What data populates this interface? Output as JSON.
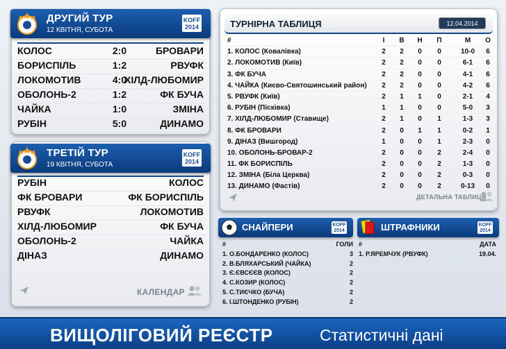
{
  "tour1": {
    "title": "ДРУГИЙ ТУР",
    "date": "12 КВІТНЯ, СУБОТА",
    "matches": [
      {
        "home": "КОЛОС",
        "score": "2:0",
        "away": "БРОВАРИ"
      },
      {
        "home": "БОРИСПІЛЬ",
        "score": "1:2",
        "away": "РВУФК"
      },
      {
        "home": "ЛОКОМОТИВ",
        "score": "4:0",
        "away": "ХІЛД-ЛЮБОМИР"
      },
      {
        "home": "ОБОЛОНЬ-2",
        "score": "1:2",
        "away": "ФК БУЧА"
      },
      {
        "home": "ЧАЙКА",
        "score": "1:0",
        "away": "ЗМІНА"
      },
      {
        "home": "РУБІН",
        "score": "5:0",
        "away": "ДИНАМО"
      }
    ]
  },
  "tour2": {
    "title": "ТРЕТІЙ ТУР",
    "date": "19 КВІТНЯ, СУБОТА",
    "matches": [
      {
        "home": "РУБІН",
        "away": "КОЛОС"
      },
      {
        "home": "ФК БРОВАРИ",
        "away": "ФК БОРИСПІЛЬ"
      },
      {
        "home": "РВУФК",
        "away": "ЛОКОМОТИВ"
      },
      {
        "home": "ХІЛД-ЛЮБОМИР",
        "away": "ФК БУЧА"
      },
      {
        "home": "ОБОЛОНЬ-2",
        "away": "ЧАЙКА"
      },
      {
        "home": "ДІНАЗ",
        "away": "ДИНАМО"
      }
    ],
    "calendar_label": "КАЛЕНДАР"
  },
  "koff": {
    "line1": "KOFF",
    "line2": "2014"
  },
  "standings": {
    "title": "ТУРНІРНА ТАБЛИЦЯ",
    "date": "12.04.2014",
    "headers": [
      "#",
      "І",
      "В",
      "Н",
      "П",
      "М",
      "О"
    ],
    "rows": [
      {
        "team": "1. КОЛОС (Ковалівка)",
        "g": "2",
        "w": "2",
        "d": "0",
        "l": "0",
        "gd": "10-0",
        "p": "6"
      },
      {
        "team": "2. ЛОКОМОТИВ (Київ)",
        "g": "2",
        "w": "2",
        "d": "0",
        "l": "0",
        "gd": "6-1",
        "p": "6"
      },
      {
        "team": "3. ФК БУЧА",
        "g": "2",
        "w": "2",
        "d": "0",
        "l": "0",
        "gd": "4-1",
        "p": "6"
      },
      {
        "team": "4. ЧАЙКА (Києво-Святошинський район)",
        "g": "2",
        "w": "2",
        "d": "0",
        "l": "0",
        "gd": "4-2",
        "p": "6"
      },
      {
        "team": "5. РВУФК (Київ)",
        "g": "2",
        "w": "1",
        "d": "1",
        "l": "0",
        "gd": "2-1",
        "p": "4"
      },
      {
        "team": "6. РУБІН (Пісківка)",
        "g": "1",
        "w": "1",
        "d": "0",
        "l": "0",
        "gd": "5-0",
        "p": "3"
      },
      {
        "team": "7. ХІЛД-ЛЮБОМИР (Ставище)",
        "g": "2",
        "w": "1",
        "d": "0",
        "l": "1",
        "gd": "1-3",
        "p": "3"
      },
      {
        "team": "8. ФК БРОВАРИ",
        "g": "2",
        "w": "0",
        "d": "1",
        "l": "1",
        "gd": "0-2",
        "p": "1"
      },
      {
        "team": "9. ДІНАЗ (Вишгород)",
        "g": "1",
        "w": "0",
        "d": "0",
        "l": "1",
        "gd": "2-3",
        "p": "0"
      },
      {
        "team": "10. ОБОЛОНЬ-БРОВАР-2",
        "g": "2",
        "w": "0",
        "d": "0",
        "l": "2",
        "gd": "2-4",
        "p": "0"
      },
      {
        "team": "11. ФК БОРИСПІЛЬ",
        "g": "2",
        "w": "0",
        "d": "0",
        "l": "2",
        "gd": "1-3",
        "p": "0"
      },
      {
        "team": "12. ЗМІНА (Біла Церква)",
        "g": "2",
        "w": "0",
        "d": "0",
        "l": "2",
        "gd": "0-3",
        "p": "0"
      },
      {
        "team": "13. ДИНАМО (Фастів)",
        "g": "2",
        "w": "0",
        "d": "0",
        "l": "2",
        "gd": "0-13",
        "p": "0"
      }
    ],
    "details_label": "ДЕТАЛЬНА ТАБЛИЦЯ"
  },
  "scorers": {
    "title": "СНАЙПЕРИ",
    "col_num": "#",
    "col_goals": "ГОЛИ",
    "rows": [
      {
        "name": "1. О.БОНДАРЕНКО (КОЛОС)",
        "goals": "3"
      },
      {
        "name": "2. В.БЛЯХАРСЬКИЙ (ЧАЙКА)",
        "goals": "2"
      },
      {
        "name": "3. Є.ЄВСЄЄВ (КОЛОС)",
        "goals": "2"
      },
      {
        "name": "4. С.КОЗИР (КОЛОС)",
        "goals": "2"
      },
      {
        "name": "5. С.ТИЄЧКО (БУЧА)",
        "goals": "2"
      },
      {
        "name": "6. І.ШТОНДЕНКО (РУБІН)",
        "goals": "2"
      }
    ]
  },
  "penalties": {
    "title": "ШТРАФНИКИ",
    "col_num": "#",
    "col_date": "ДАТА",
    "rows": [
      {
        "name": "1. Р.ЯРЕМЧУК (РВУФК)",
        "date": "19.04."
      }
    ]
  },
  "footer": {
    "main": "ВИЩОЛІГОВИЙ РЕЄСТР",
    "sub": "Статистичні дані"
  },
  "icons": {
    "logo": "federation-logo-icon",
    "calendar": "people-icon",
    "arrow": "arrow-icon",
    "ball": "soccer-ball-icon",
    "card": "red-card-icon"
  },
  "colors": {
    "header_blue": "#0f4587",
    "card_red": "#e01818",
    "card_yellow": "#f5d90a"
  }
}
